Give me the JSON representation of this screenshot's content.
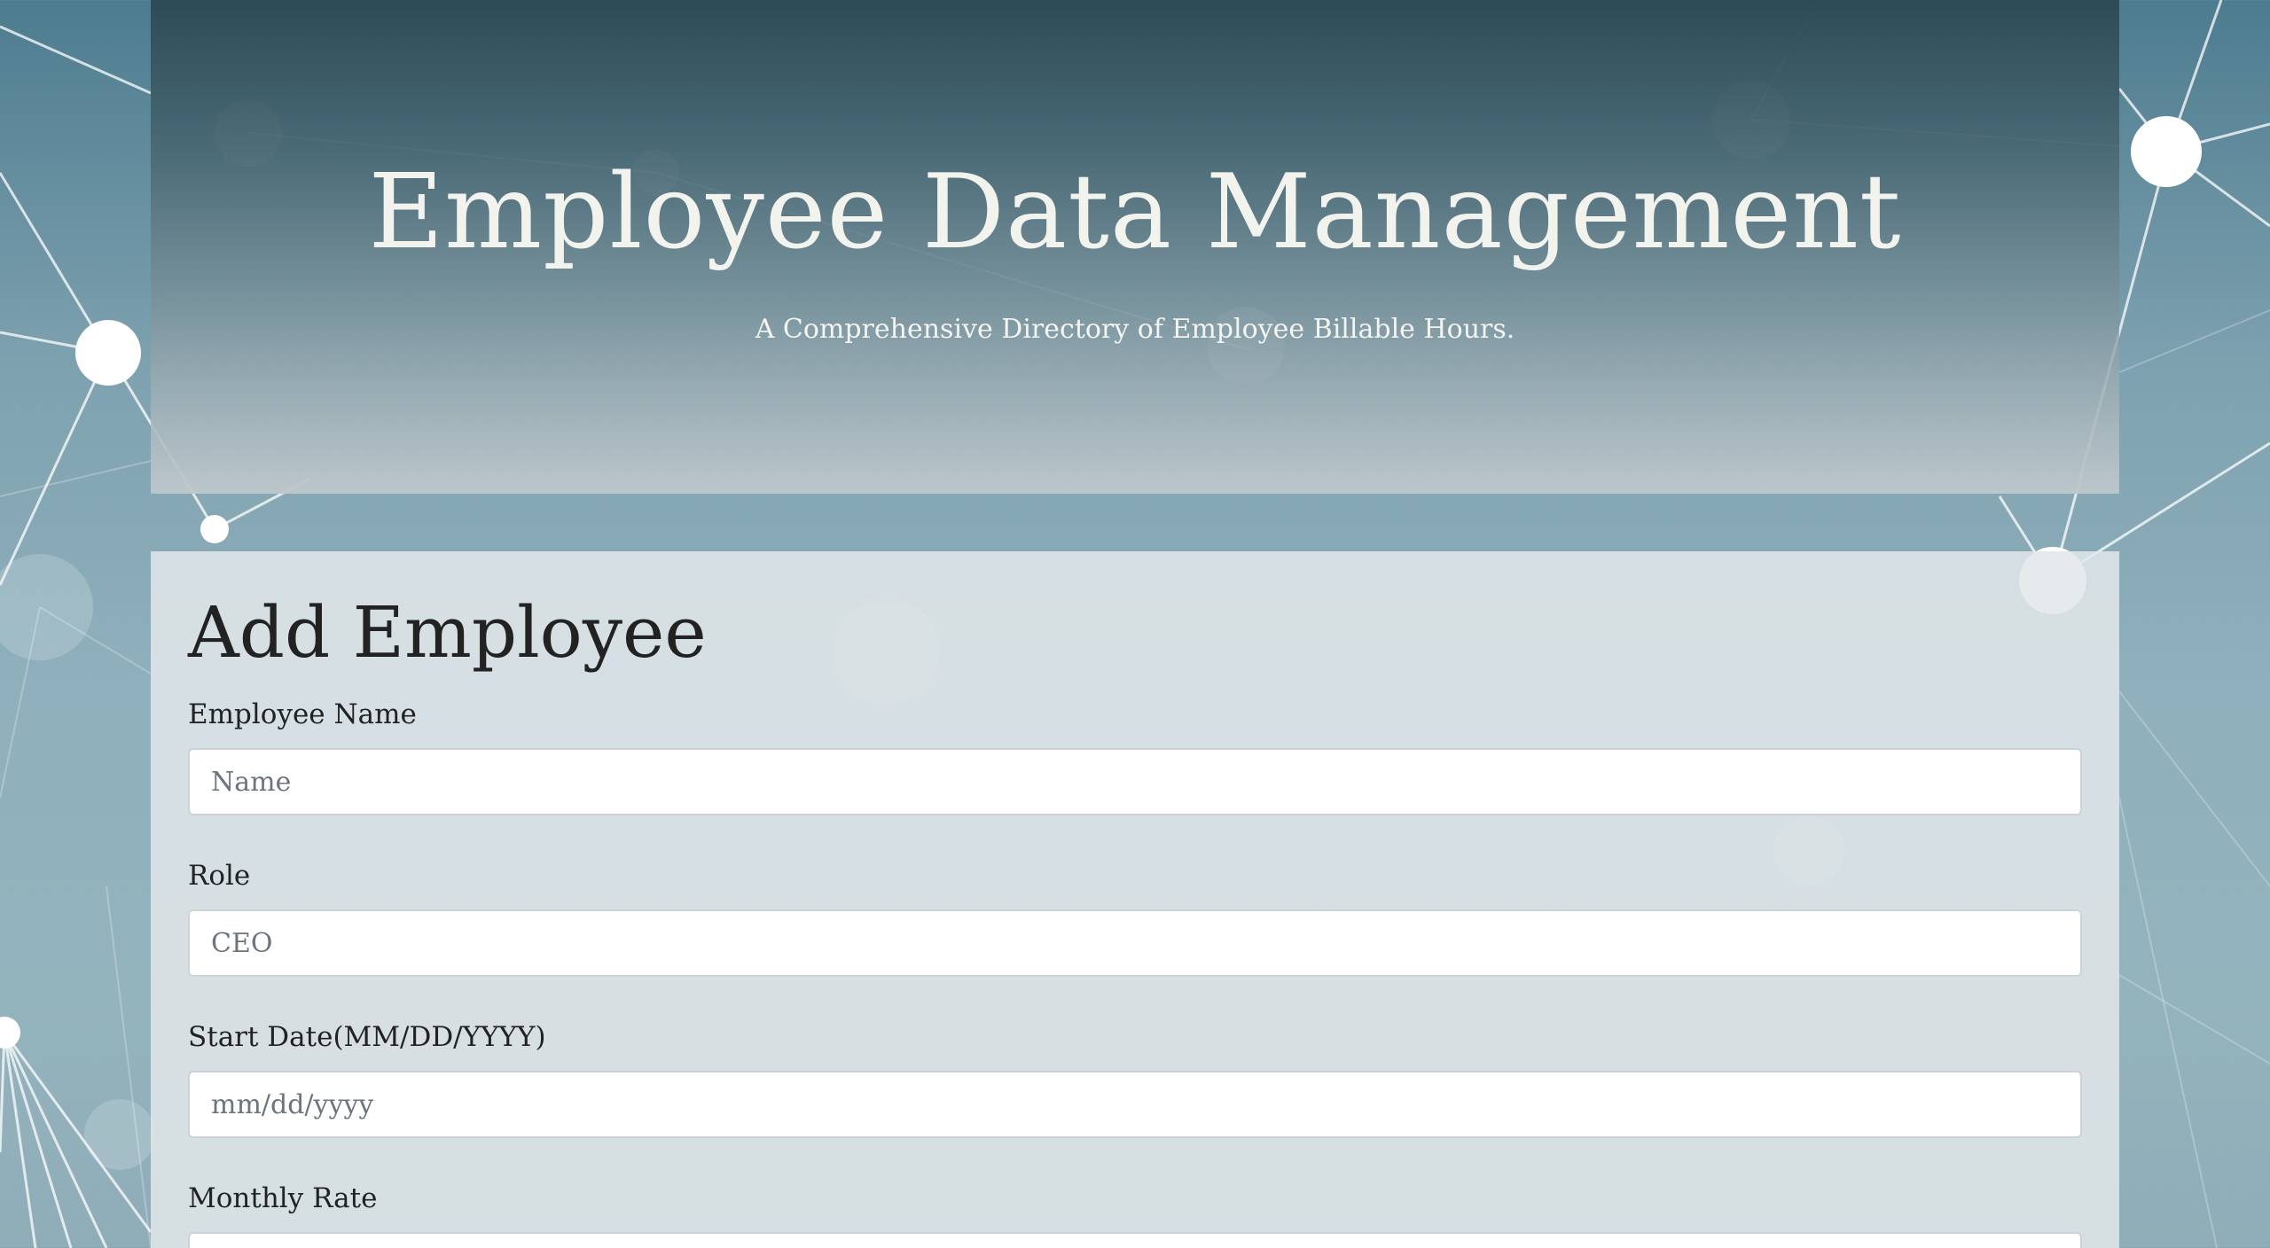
{
  "header": {
    "title": "Employee Data Management",
    "subtitle": "A Comprehensive Directory of Employee Billable Hours."
  },
  "form": {
    "heading": "Add Employee",
    "fields": {
      "name": {
        "label": "Employee Name",
        "placeholder": "Name",
        "value": ""
      },
      "role": {
        "label": "Role",
        "placeholder": "CEO",
        "value": ""
      },
      "start_date": {
        "label": "Start Date(MM/DD/YYYY)",
        "placeholder": "mm/dd/yyyy",
        "value": ""
      },
      "monthly_rate": {
        "label": "Monthly Rate",
        "placeholder": "",
        "value": ""
      }
    }
  },
  "colors": {
    "background": "#7fa2b0",
    "header_dark": "#2b4854",
    "panel": "#e2e7e9",
    "text": "#222222"
  },
  "icons": {
    "background": "network-graph-background"
  }
}
